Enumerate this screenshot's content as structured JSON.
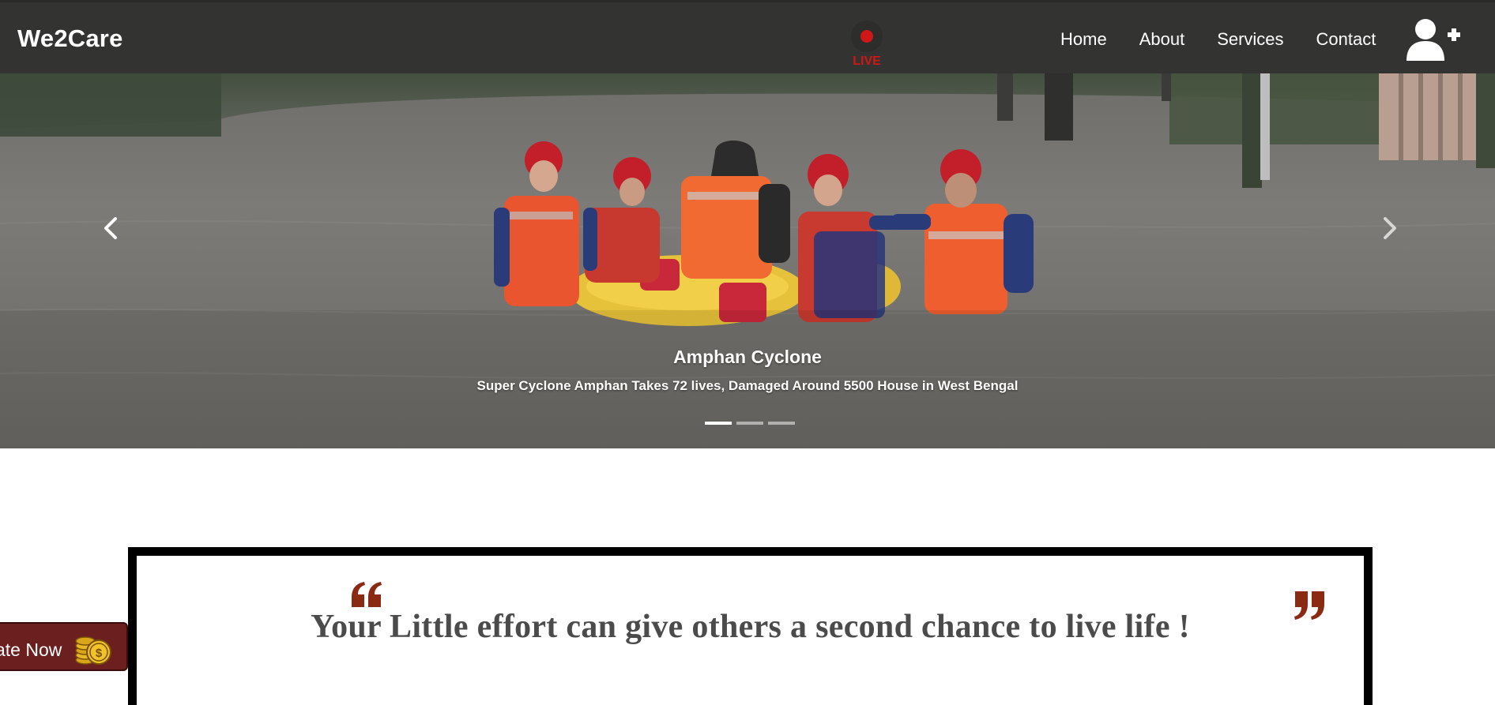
{
  "navbar": {
    "brand": "We2Care",
    "live_label": "LIVE",
    "links": [
      {
        "label": "Home"
      },
      {
        "label": "About"
      },
      {
        "label": "Services"
      },
      {
        "label": "Contact"
      }
    ],
    "user_icon": "user-plus-icon"
  },
  "carousel": {
    "title": "Amphan Cyclone",
    "caption": "Super Cyclone Amphan Takes 72 lives, Damaged Around 5500 House in West Bengal",
    "slides_count": 3,
    "active_slide": 1,
    "prev_icon": "chevron-left-icon",
    "next_icon": "chevron-right-icon"
  },
  "quote": {
    "text": "Your Little effort can give others a second chance to live life !",
    "open_icon": "quote-open-icon",
    "close_icon": "quote-close-icon"
  },
  "donate": {
    "label": "ate Now",
    "icon": "coins-icon"
  },
  "colors": {
    "navbar_bg": "#333431",
    "live_red": "#d01717",
    "quote_mark": "#8b2a12",
    "donate_bg": "#6b1f1f"
  }
}
